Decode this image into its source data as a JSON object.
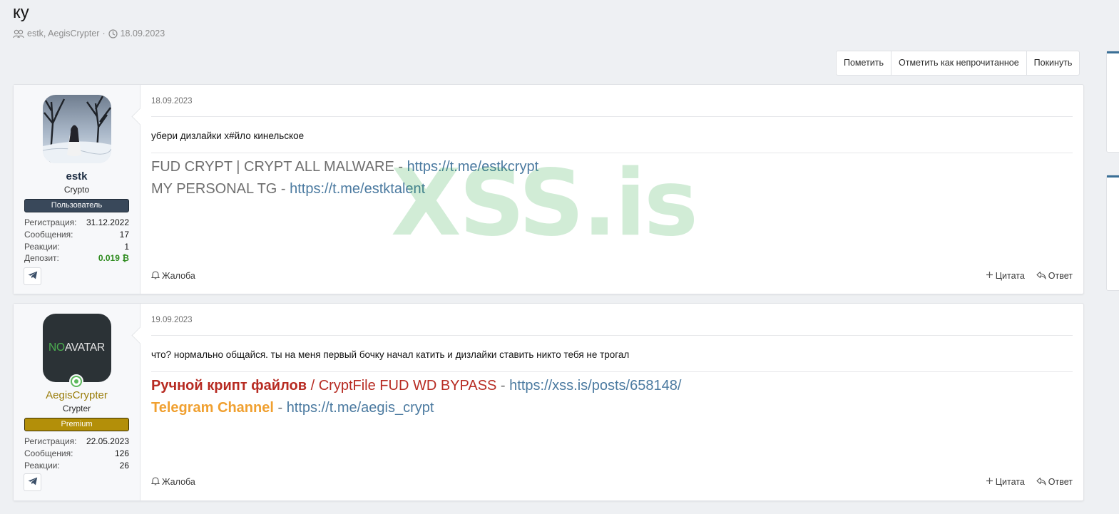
{
  "thread": {
    "title": "ку",
    "participants": "estk, AegisCrypter",
    "separator": "·",
    "date": "18.09.2023"
  },
  "actions": [
    {
      "label": "Пометить"
    },
    {
      "label": "Отметить как непрочитанное"
    },
    {
      "label": "Покинуть"
    }
  ],
  "posts": [
    {
      "date": "18.09.2023",
      "user": {
        "name": "estk",
        "name_color": "#1f2f44",
        "title": "Crypto",
        "banner": "Пользователь",
        "banner_bg": "#39485a",
        "banner_color": "#ffffff",
        "stats": [
          {
            "label": "Регистрация:",
            "value": "31.12.2022"
          },
          {
            "label": "Сообщения:",
            "value": "17"
          },
          {
            "label": "Реакции:",
            "value": "1"
          },
          {
            "label": "Депозит:",
            "value": "0.019 ₿"
          }
        ]
      },
      "message": "убери дизлайки х#йло кинельское",
      "signature": [
        {
          "text": "FUD CRYPT | CRYPT ALL MALWARE - ",
          "link": "https://t.me/estkcrypt"
        },
        {
          "text": "MY PERSONAL TG - ",
          "link": "https://t.me/estktalent"
        }
      ],
      "report": "Жалоба",
      "quote": "Цитата",
      "reply": "Ответ"
    },
    {
      "date": "19.09.2023",
      "user": {
        "name": "AegisCrypter",
        "name_color": "#9a7d0a",
        "title": "Crypter",
        "avatar_text_1": "NO",
        "avatar_text_2": "AVATAR",
        "banner": "Premium",
        "banner_bg": "#b38f09",
        "banner_color": "#ffffff",
        "stats": [
          {
            "label": "Регистрация:",
            "value": "22.05.2023"
          },
          {
            "label": "Сообщения:",
            "value": "126"
          },
          {
            "label": "Реакции:",
            "value": "26"
          }
        ]
      },
      "message": "что? нормально общайся. ты на меня первый бочку начал катить и дизлайки ставить никто тебя не трогал",
      "signature_line1": {
        "bold": "Ручной крипт файлов",
        "plain": " / CryptFile FUD WD BYPASS",
        "dash": " - ",
        "link": "https://xss.is/posts/658148/"
      },
      "signature_line2": {
        "bold": "Telegram Channel",
        "dash": " - ",
        "link": "https://t.me/aegis_crypt"
      },
      "report": "Жалоба",
      "quote": "Цитата",
      "reply": "Ответ"
    }
  ],
  "watermark": "XSS.is",
  "colors": {
    "accent_link": "#4b7aa0",
    "red": "#b72b22",
    "orange": "#f0a030",
    "deposit_green": "#2e8b1e"
  }
}
